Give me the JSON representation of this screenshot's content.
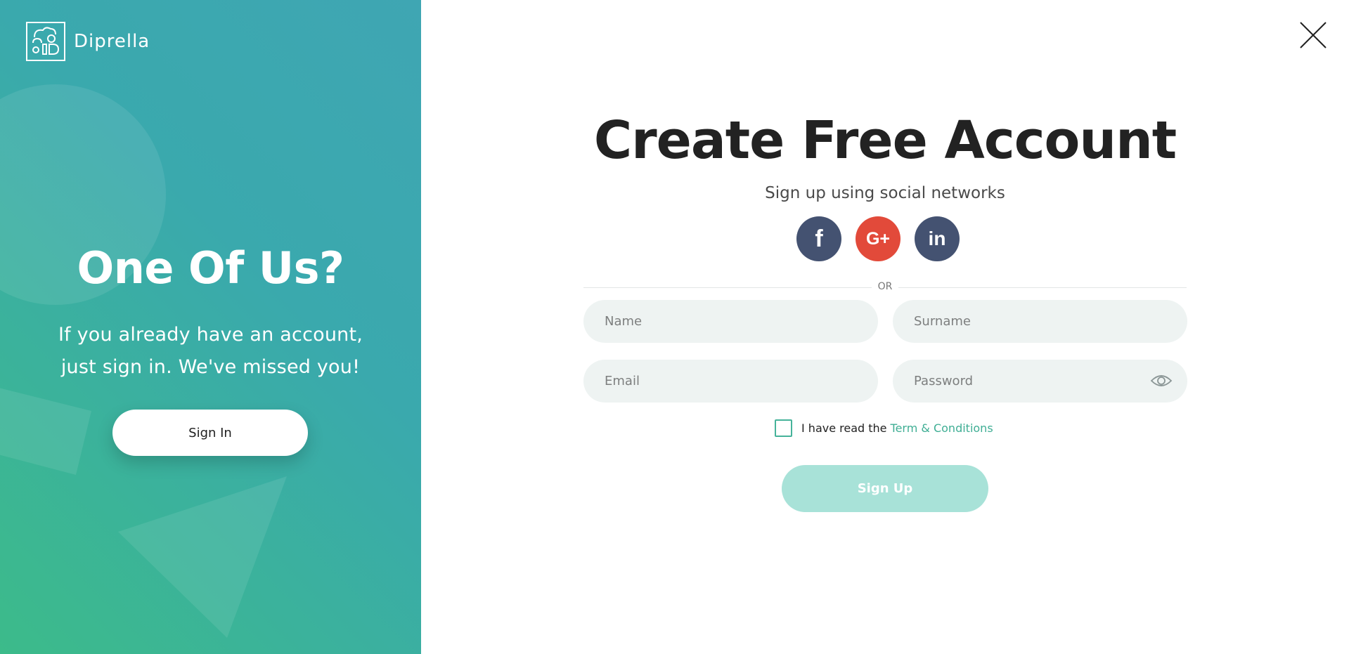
{
  "brand": {
    "name": "Diprella"
  },
  "left": {
    "title": "One Of Us?",
    "text_line1": "If you already have an account,",
    "text_line2": "just sign in. We've missed you!",
    "signin_label": "Sign In"
  },
  "form": {
    "title": "Create Free Account",
    "subtitle": "Sign up using social networks",
    "social": [
      {
        "icon": "facebook-icon",
        "glyph": "f"
      },
      {
        "icon": "google-plus-icon",
        "glyph": "G+"
      },
      {
        "icon": "linkedin-icon",
        "glyph": "in"
      }
    ],
    "or_text": "OR",
    "fields": {
      "name": {
        "placeholder": "Name",
        "value": ""
      },
      "surname": {
        "placeholder": "Surname",
        "value": ""
      },
      "email": {
        "placeholder": "Email",
        "value": ""
      },
      "password": {
        "placeholder": "Password",
        "value": ""
      }
    },
    "terms_text": "I have read the",
    "terms_link": "Term & Conditions",
    "signup_label": "Sign Up"
  },
  "colors": {
    "gradient_start": "#3cbb8a",
    "gradient_end": "#3fa6b3",
    "facebook": "#445271",
    "google": "#e24a3a",
    "linkedin": "#445271",
    "signup_button": "#a8e2d8",
    "accent": "#3fae94"
  }
}
